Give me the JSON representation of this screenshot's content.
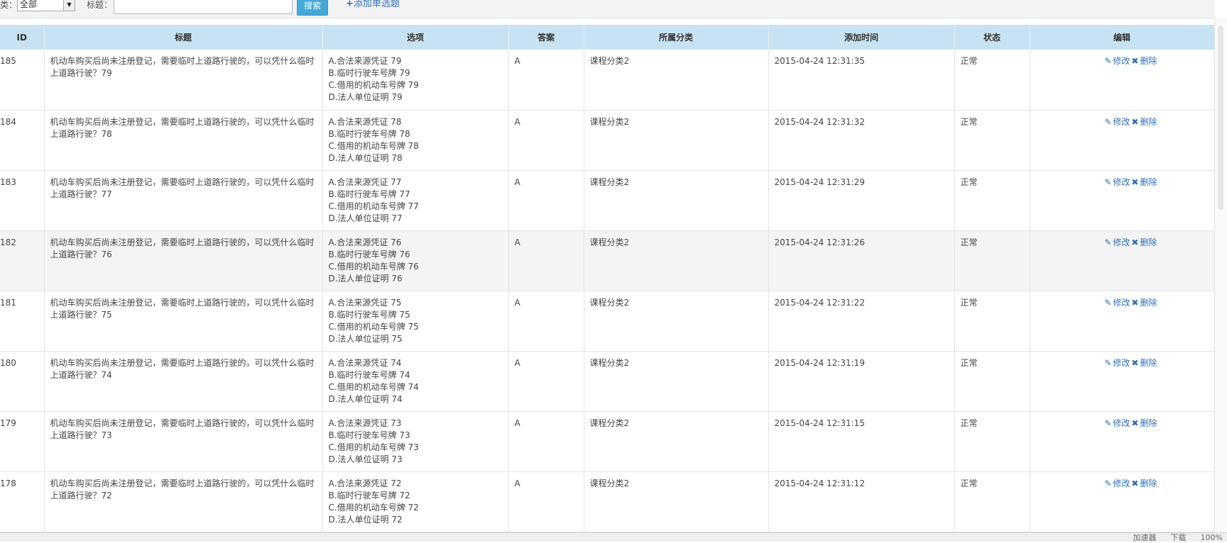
{
  "toolbar": {
    "category_label": "类：",
    "category_value": "全部",
    "title_label": "标题：",
    "title_value": "",
    "search_button": "搜索",
    "add_link": "添加单选题"
  },
  "table": {
    "headers": [
      "ID",
      "标题",
      "选项",
      "答案",
      "所属分类",
      "添加时间",
      "状态",
      "编辑"
    ],
    "edit_label": "修改",
    "delete_label": "删除",
    "rows": [
      {
        "id": "185",
        "title": "机动车购买后尚未注册登记，需要临时上道路行驶的，可以凭什么临时上道路行驶？79",
        "options": [
          "A.合法来源凭证 79",
          "B.临时行驶车号牌 79",
          "C.借用的机动车号牌 79",
          "D.法人单位证明 79"
        ],
        "answer": "A",
        "category": "课程分类2",
        "time": "2015-04-24 12:31:35",
        "status": "正常"
      },
      {
        "id": "184",
        "title": "机动车购买后尚未注册登记，需要临时上道路行驶的，可以凭什么临时上道路行驶？78",
        "options": [
          "A.合法来源凭证 78",
          "B.临时行驶车号牌 78",
          "C.借用的机动车号牌 78",
          "D.法人单位证明 78"
        ],
        "answer": "A",
        "category": "课程分类2",
        "time": "2015-04-24 12:31:32",
        "status": "正常"
      },
      {
        "id": "183",
        "title": "机动车购买后尚未注册登记，需要临时上道路行驶的，可以凭什么临时上道路行驶？77",
        "options": [
          "A.合法来源凭证 77",
          "B.临时行驶车号牌 77",
          "C.借用的机动车号牌 77",
          "D.法人单位证明 77"
        ],
        "answer": "A",
        "category": "课程分类2",
        "time": "2015-04-24 12:31:29",
        "status": "正常"
      },
      {
        "id": "182",
        "title": "机动车购买后尚未注册登记，需要临时上道路行驶的，可以凭什么临时上道路行驶？76",
        "options": [
          "A.合法来源凭证 76",
          "B.临时行驶车号牌 76",
          "C.借用的机动车号牌 76",
          "D.法人单位证明 76"
        ],
        "answer": "A",
        "category": "课程分类2",
        "time": "2015-04-24 12:31:26",
        "status": "正常"
      },
      {
        "id": "181",
        "title": "机动车购买后尚未注册登记，需要临时上道路行驶的，可以凭什么临时上道路行驶？75",
        "options": [
          "A.合法来源凭证 75",
          "B.临时行驶车号牌 75",
          "C.借用的机动车号牌 75",
          "D.法人单位证明 75"
        ],
        "answer": "A",
        "category": "课程分类2",
        "time": "2015-04-24 12:31:22",
        "status": "正常"
      },
      {
        "id": "180",
        "title": "机动车购买后尚未注册登记，需要临时上道路行驶的，可以凭什么临时上道路行驶？74",
        "options": [
          "A.合法来源凭证 74",
          "B.临时行驶车号牌 74",
          "C.借用的机动车号牌 74",
          "D.法人单位证明 74"
        ],
        "answer": "A",
        "category": "课程分类2",
        "time": "2015-04-24 12:31:19",
        "status": "正常"
      },
      {
        "id": "179",
        "title": "机动车购买后尚未注册登记，需要临时上道路行驶的，可以凭什么临时上道路行驶？73",
        "options": [
          "A.合法来源凭证 73",
          "B.临时行驶车号牌 73",
          "C.借用的机动车号牌 73",
          "D.法人单位证明 73"
        ],
        "answer": "A",
        "category": "课程分类2",
        "time": "2015-04-24 12:31:15",
        "status": "正常"
      },
      {
        "id": "178",
        "title": "机动车购买后尚未注册登记，需要临时上道路行驶的，可以凭什么临时上道路行驶？72",
        "options": [
          "A.合法来源凭证 72",
          "B.临时行驶车号牌 72",
          "C.借用的机动车号牌 72",
          "D.法人单位证明 72"
        ],
        "answer": "A",
        "category": "课程分类2",
        "time": "2015-04-24 12:31:12",
        "status": "正常"
      }
    ]
  },
  "statusbar": {
    "items": [
      "加速器",
      "下载",
      "100%"
    ]
  },
  "icons": {
    "edit": "pencil-icon",
    "delete": "close-icon"
  },
  "colors": {
    "header_bg": "#c7e3f3",
    "link": "#2f6fb5",
    "search_button": "#44a9d6"
  }
}
